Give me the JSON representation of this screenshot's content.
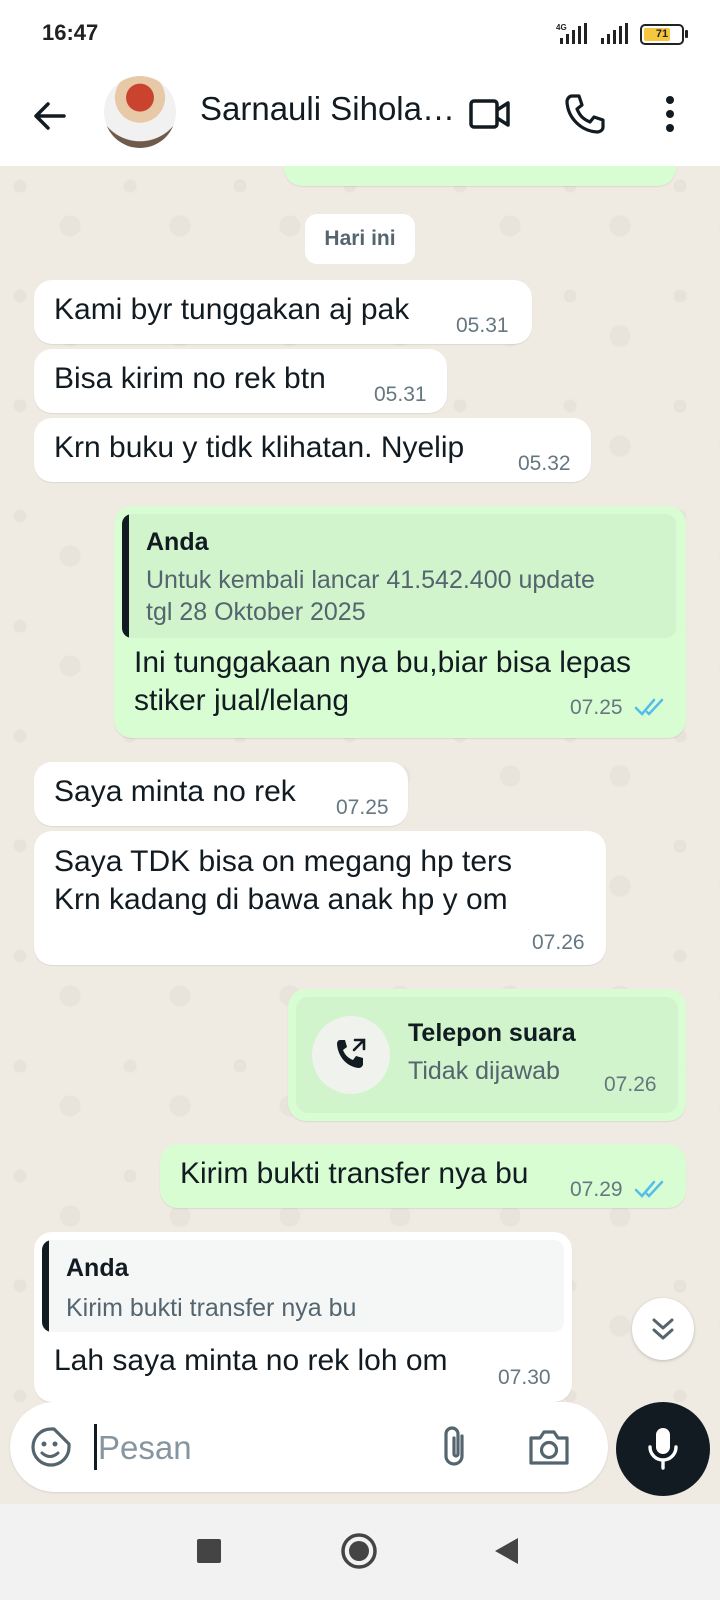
{
  "status_bar": {
    "time": "16:47",
    "network": "4G",
    "battery_level": "71",
    "battery_fraction": 0.71
  },
  "header": {
    "contact_name": "Sarnauli Sihola…"
  },
  "chat": {
    "date_chip": "Hari ini",
    "messages": [
      {
        "text": "Kami byr tunggakan aj pak",
        "time": "05.31"
      },
      {
        "text": "Bisa kirim no rek btn",
        "time": "05.31"
      },
      {
        "text": "Krn buku y tidk klihatan. Nyelip",
        "time": "05.32"
      },
      {
        "quote_author": "Anda",
        "quote_text": "Untuk kembali lancar 41.542.400 update\ntgl 28  Oktober 2025",
        "text": "Ini tunggakaan nya bu,biar bisa lepas\nstiker jual/lelang",
        "time": "07.25"
      },
      {
        "text": "Saya minta no rek",
        "time": "07.25"
      },
      {
        "text": "Saya TDK bisa on megang hp ters\nKrn kadang di bawa anak hp y om",
        "time": "07.26"
      },
      {
        "call_title": "Telepon suara",
        "call_subtitle": "Tidak dijawab",
        "time": "07.26"
      },
      {
        "text": "Kirim bukti transfer nya bu",
        "time": "07.29"
      },
      {
        "quote_author": "Anda",
        "quote_text": "Kirim bukti transfer nya bu",
        "text": "Lah saya minta no rek loh om",
        "time": "07.30"
      }
    ]
  },
  "composer": {
    "placeholder": "Pesan"
  },
  "colors": {
    "incoming": "#ffffff",
    "outgoing": "#d9fdd3",
    "read_ticks": "#53bdeb",
    "quote_bg_out": "#d1f4cc",
    "quote_bg_in": "#f5f6f6"
  }
}
